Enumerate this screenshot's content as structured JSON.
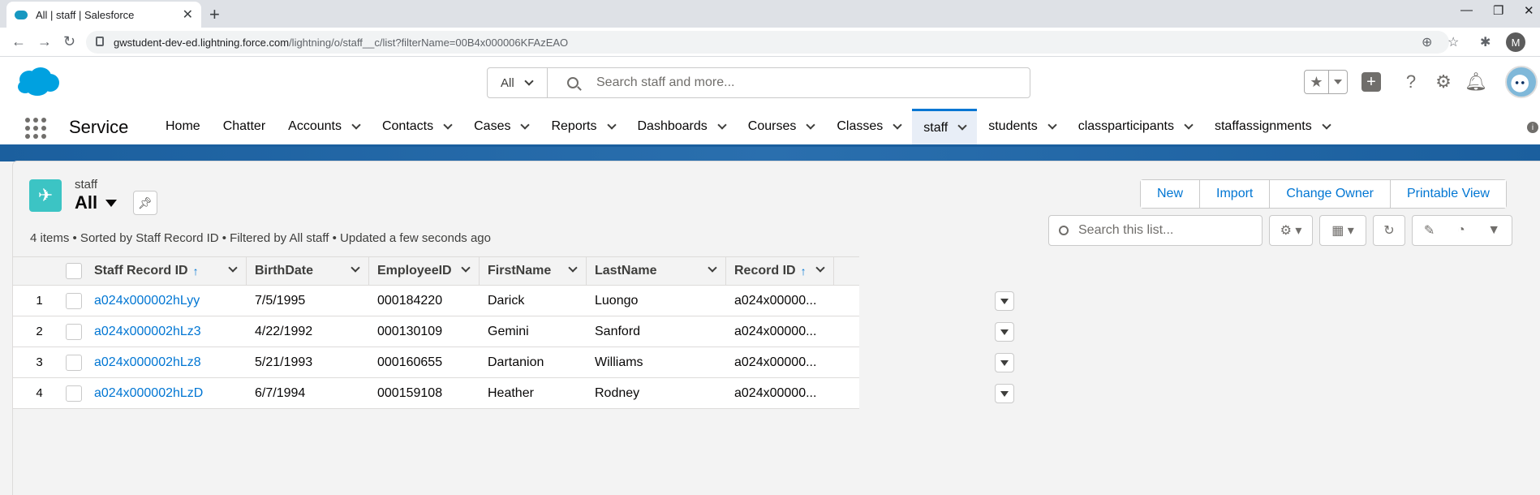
{
  "browser": {
    "tab_title": "All | staff | Salesforce",
    "url_host": "gwstudent-dev-ed.lightning.force.com",
    "url_path": "/lightning/o/staff__c/list?filterName=00B4x000006KFAzEAO",
    "profile_initial": "M"
  },
  "header": {
    "search_scope": "All",
    "search_placeholder": "Search staff and more..."
  },
  "nav": {
    "app_name": "Service",
    "items": [
      {
        "label": "Home",
        "has_menu": false
      },
      {
        "label": "Chatter",
        "has_menu": false
      },
      {
        "label": "Accounts",
        "has_menu": true
      },
      {
        "label": "Contacts",
        "has_menu": true
      },
      {
        "label": "Cases",
        "has_menu": true
      },
      {
        "label": "Reports",
        "has_menu": true
      },
      {
        "label": "Dashboards",
        "has_menu": true
      },
      {
        "label": "Courses",
        "has_menu": true
      },
      {
        "label": "Classes",
        "has_menu": true
      },
      {
        "label": "staff",
        "has_menu": true,
        "active": true
      },
      {
        "label": "students",
        "has_menu": true
      },
      {
        "label": "classparticipants",
        "has_menu": true
      },
      {
        "label": "staffassignments",
        "has_menu": true
      }
    ]
  },
  "listview": {
    "object_label": "staff",
    "view_name": "All",
    "meta": "4 items • Sorted by Staff Record ID • Filtered by All staff • Updated a few seconds ago",
    "buttons": {
      "new": "New",
      "import": "Import",
      "change_owner": "Change Owner",
      "printable_view": "Printable View"
    },
    "search_placeholder": "Search this list...",
    "columns": [
      {
        "label": "Staff Record ID",
        "sorted": true
      },
      {
        "label": "BirthDate",
        "sorted": false
      },
      {
        "label": "EmployeeID",
        "sorted": false
      },
      {
        "label": "FirstName",
        "sorted": false
      },
      {
        "label": "LastName",
        "sorted": false
      },
      {
        "label": "Record ID",
        "sorted": true
      }
    ],
    "rows": [
      {
        "num": "1",
        "staff_id": "a024x000002hLyy",
        "birthdate": "7/5/1995",
        "employee_id": "000184220",
        "first": "Darick",
        "last": "Luongo",
        "record_id": "a024x00000..."
      },
      {
        "num": "2",
        "staff_id": "a024x000002hLz3",
        "birthdate": "4/22/1992",
        "employee_id": "000130109",
        "first": "Gemini",
        "last": "Sanford",
        "record_id": "a024x00000..."
      },
      {
        "num": "3",
        "staff_id": "a024x000002hLz8",
        "birthdate": "5/21/1993",
        "employee_id": "000160655",
        "first": "Dartanion",
        "last": "Williams",
        "record_id": "a024x00000..."
      },
      {
        "num": "4",
        "staff_id": "a024x000002hLzD",
        "birthdate": "6/7/1994",
        "employee_id": "000159108",
        "first": "Heather",
        "last": "Rodney",
        "record_id": "a024x00000..."
      }
    ]
  }
}
